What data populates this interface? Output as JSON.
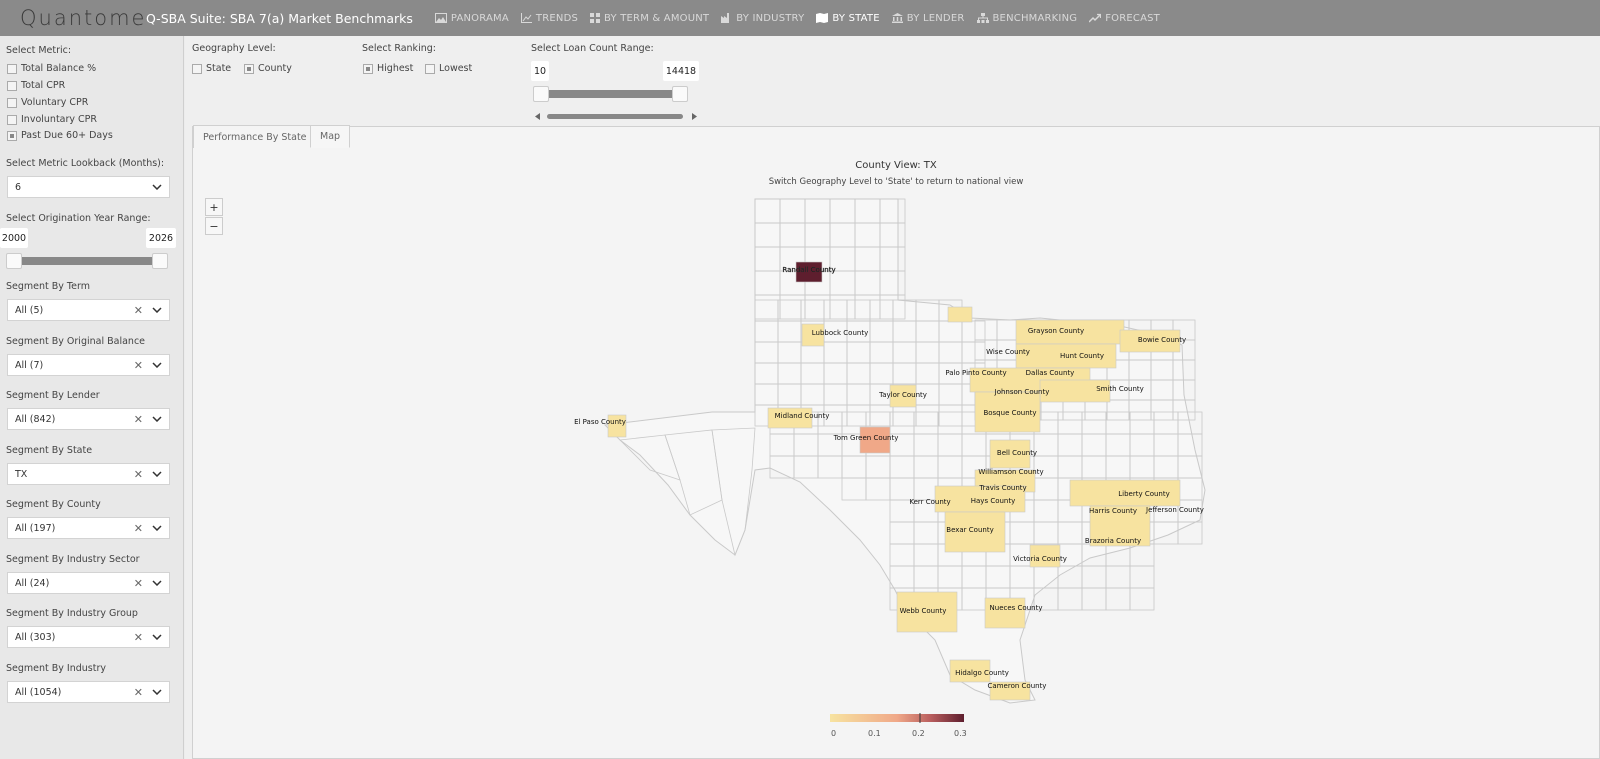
{
  "header": {
    "brand": "Quantome",
    "suite_title": "Q-SBA Suite: SBA 7(a) Market Benchmarks",
    "nav": [
      {
        "label": "PANORAMA",
        "icon": "image-icon"
      },
      {
        "label": "TRENDS",
        "icon": "line-chart-icon"
      },
      {
        "label": "BY TERM & AMOUNT",
        "icon": "grid-icon"
      },
      {
        "label": "BY INDUSTRY",
        "icon": "factory-icon"
      },
      {
        "label": "BY STATE",
        "icon": "map-icon"
      },
      {
        "label": "BY LENDER",
        "icon": "bank-icon"
      },
      {
        "label": "BENCHMARKING",
        "icon": "sitemap-icon"
      },
      {
        "label": "FORECAST",
        "icon": "trend-up-icon"
      }
    ],
    "active_nav": "BY STATE"
  },
  "sidebar": {
    "metric_label": "Select Metric:",
    "metrics": [
      {
        "label": "Total Balance %",
        "checked": false
      },
      {
        "label": "Total CPR",
        "checked": false
      },
      {
        "label": "Voluntary CPR",
        "checked": false
      },
      {
        "label": "Involuntary CPR",
        "checked": false
      },
      {
        "label": "Past Due 60+ Days",
        "checked": true
      }
    ],
    "lookback_label": "Select Metric Lookback (Months):",
    "lookback_value": "6",
    "orig_year_label": "Select Origination Year Range:",
    "orig_year_min": "2000",
    "orig_year_max": "2026",
    "segments": [
      {
        "label": "Segment By Term",
        "value": "All (5)"
      },
      {
        "label": "Segment By Original Balance",
        "value": "All (7)"
      },
      {
        "label": "Segment By Lender",
        "value": "All (842)"
      },
      {
        "label": "Segment By State",
        "value": "TX"
      },
      {
        "label": "Segment By County",
        "value": "All (197)"
      },
      {
        "label": "Segment By Industry Sector",
        "value": "All (24)"
      },
      {
        "label": "Segment By Industry Group",
        "value": "All (303)"
      },
      {
        "label": "Segment By Industry",
        "value": "All (1054)"
      }
    ]
  },
  "filters": {
    "geography_label": "Geography Level:",
    "geo_state": "State",
    "geo_county": "County",
    "ranking_label": "Select Ranking:",
    "rank_highest": "Highest",
    "rank_lowest": "Lowest",
    "loan_count_label": "Select Loan Count Range:",
    "loan_min": "10",
    "loan_max": "14418"
  },
  "tabs": [
    "Performance By State",
    "Map"
  ],
  "active_tab": "Map",
  "map": {
    "title": "County View: TX",
    "subtitle": "Switch Geography Level to 'State' to return to national view",
    "zoom_in": "+",
    "zoom_out": "−",
    "legend_ticks": [
      "0",
      "0.1",
      "0.2",
      "0.3"
    ],
    "colors": {
      "low": "#f7e3a0",
      "mid": "#f0a888",
      "high": "#5e1e2e",
      "empty": "#f7f7f7",
      "stroke": "#c9c9c9"
    },
    "counties": [
      "Randall County",
      "Lubbock County",
      "El Paso County",
      "Midland County",
      "Tom Green County",
      "Taylor County",
      "Palo Pinto County",
      "Wise County",
      "Grayson County",
      "Bowie County",
      "Hunt County",
      "Dallas County",
      "Johnson County",
      "Smith County",
      "Bosque County",
      "Bell County",
      "Williamson County",
      "Travis County",
      "Hays County",
      "Kerr County",
      "Bexar County",
      "Liberty County",
      "Harris County",
      "Jefferson County",
      "Brazoria County",
      "Victoria County",
      "Webb County",
      "Nueces County",
      "Hidalgo County",
      "Cameron County"
    ]
  }
}
